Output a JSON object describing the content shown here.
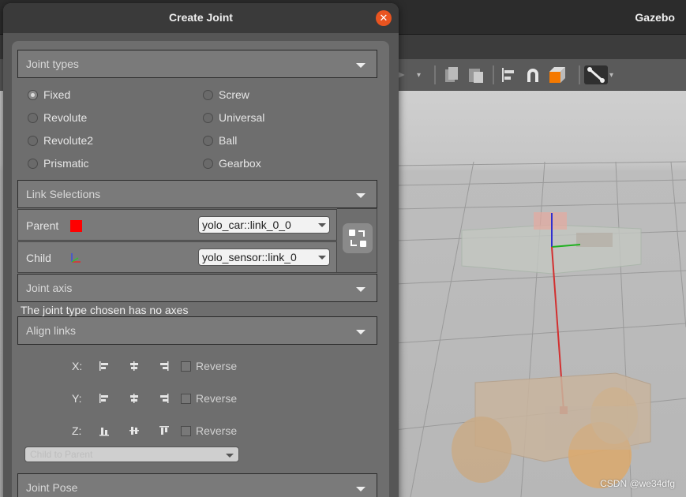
{
  "gazebo": {
    "title": "Gazebo",
    "watermark": "CSDN @we34dfg"
  },
  "dialog": {
    "title": "Create Joint",
    "close_icon": "close-icon"
  },
  "joint_types": {
    "header": "Joint types",
    "options": [
      "Fixed",
      "Screw",
      "Revolute",
      "Universal",
      "Revolute2",
      "Ball",
      "Prismatic",
      "Gearbox"
    ],
    "selected": "Fixed"
  },
  "link_selections": {
    "header": "Link Selections",
    "parent_label": "Parent",
    "parent_value": "yolo_car::link_0_0",
    "child_label": "Child",
    "child_value": "yolo_sensor::link_0",
    "parent_color": "#ff0000"
  },
  "joint_axis": {
    "header": "Joint axis",
    "note": "The joint type chosen has no axes"
  },
  "align_links": {
    "header": "Align links",
    "rows": [
      {
        "axis": "X:",
        "reverse": "Reverse"
      },
      {
        "axis": "Y:",
        "reverse": "Reverse"
      },
      {
        "axis": "Z:",
        "reverse": "Reverse"
      }
    ],
    "align_value": "Child to Parent"
  },
  "joint_pose": {
    "header": "Joint Pose"
  },
  "colors": {
    "accent": "#e95420",
    "panel": "#6e6e6e",
    "tool_orange": "#f57900"
  }
}
